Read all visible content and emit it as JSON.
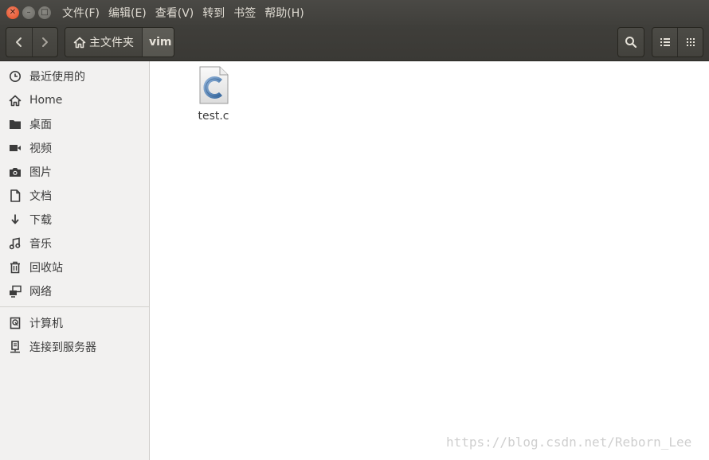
{
  "menu": {
    "items": [
      "文件(F)",
      "编辑(E)",
      "查看(V)",
      "转到",
      "书签",
      "帮助(H)"
    ]
  },
  "toolbar": {
    "path": {
      "home_label": "主文件夹",
      "current_label": "vim"
    }
  },
  "sidebar": {
    "items": [
      {
        "label": "最近使用的",
        "icon": "clock-icon"
      },
      {
        "label": "Home",
        "icon": "home-icon"
      },
      {
        "label": "桌面",
        "icon": "folder-icon"
      },
      {
        "label": "视频",
        "icon": "video-icon"
      },
      {
        "label": "图片",
        "icon": "camera-icon"
      },
      {
        "label": "文档",
        "icon": "document-icon"
      },
      {
        "label": "下载",
        "icon": "download-icon"
      },
      {
        "label": "音乐",
        "icon": "music-icon"
      },
      {
        "label": "回收站",
        "icon": "trash-icon"
      },
      {
        "label": "网络",
        "icon": "network-icon"
      }
    ],
    "devices": [
      {
        "label": "计算机",
        "icon": "computer-icon"
      },
      {
        "label": "连接到服务器",
        "icon": "server-connect-icon"
      }
    ]
  },
  "content": {
    "files": [
      {
        "name": "test.c",
        "icon": "c-source-file-icon"
      }
    ]
  },
  "watermark": "https://blog.csdn.net/Reborn_Lee",
  "colors": {
    "titlebar": "#403f3b",
    "close_button": "#df4a1e",
    "sidebar_bg": "#f2f1f0",
    "content_bg": "#ffffff"
  }
}
